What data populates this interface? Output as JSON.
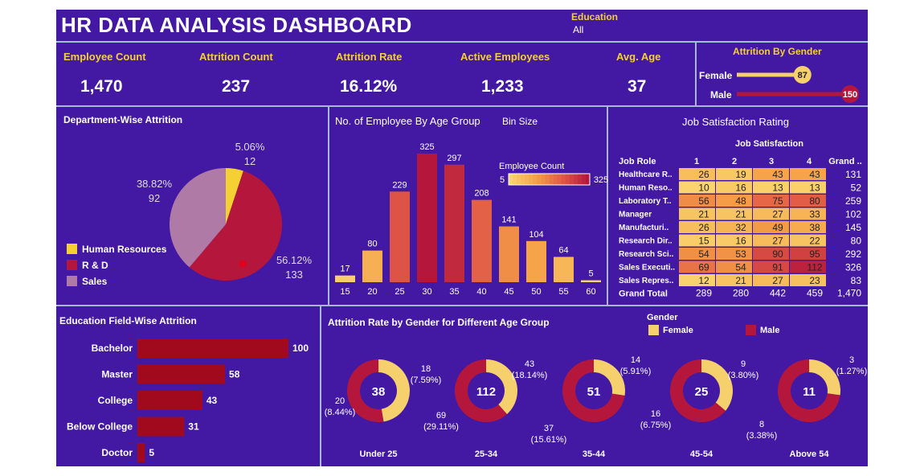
{
  "header": {
    "title": "HR DATA ANALYSIS DASHBOARD",
    "filter_label": "Education",
    "filter_value": "All"
  },
  "kpis": [
    {
      "label": "Employee Count",
      "value": "1,470"
    },
    {
      "label": "Attrition Count",
      "value": "237"
    },
    {
      "label": "Attrition Rate",
      "value": "16.12%"
    },
    {
      "label": "Active Employees",
      "value": "1,233"
    },
    {
      "label": "Avg. Age",
      "value": "37"
    }
  ],
  "colors": {
    "background": "#4319a3",
    "accent_yellow": "#f5d033",
    "female": "#f5d06c",
    "male": "#b5173c",
    "edu_bar": "#a10a1c",
    "sales": "#b07aa6",
    "hr": "#f5d033",
    "rd": "#b5173c"
  },
  "chart_data": [
    {
      "id": "gender",
      "type": "bar",
      "title": "Attrition By Gender",
      "categories": [
        "Female",
        "Male"
      ],
      "values": [
        87,
        150
      ],
      "value_labels": [
        "87",
        "150"
      ]
    },
    {
      "id": "department",
      "type": "pie",
      "title": "Department-Wise Attrition",
      "legend": [
        "Human Resources",
        "R & D",
        "Sales"
      ],
      "slices": [
        {
          "name": "Human Resources",
          "value": 12,
          "percent": "5.06%",
          "label": "12"
        },
        {
          "name": "R & D",
          "value": 133,
          "percent": "56.12%",
          "label": "133"
        },
        {
          "name": "Sales",
          "value": 92,
          "percent": "38.82%",
          "label": "92"
        }
      ]
    },
    {
      "id": "age_group",
      "type": "bar",
      "title": "No. of Employee By Age Group",
      "bin_label": "Bin Size",
      "legend_title": "Employee Count",
      "legend_min": "5",
      "legend_max": "325",
      "categories": [
        "15",
        "20",
        "25",
        "30",
        "35",
        "40",
        "45",
        "50",
        "55",
        "60"
      ],
      "values": [
        17,
        80,
        229,
        325,
        297,
        208,
        141,
        104,
        64,
        5
      ],
      "value_labels": [
        "17",
        "80",
        "229",
        "325",
        "297",
        "208",
        "141",
        "104",
        "64",
        "5"
      ]
    },
    {
      "id": "job_satisfaction",
      "type": "heatmap",
      "title": "Job Satisfaction Rating",
      "column_group": "Job Satisfaction",
      "row_header": "Job Role",
      "columns": [
        "1",
        "2",
        "3",
        "4",
        "Grand .."
      ],
      "rows": [
        {
          "role": "Healthcare R..",
          "values": [
            26,
            19,
            43,
            43
          ],
          "labels": [
            "26",
            "19",
            "43",
            "43"
          ],
          "total": "131"
        },
        {
          "role": "Human Reso..",
          "values": [
            10,
            16,
            13,
            13
          ],
          "labels": [
            "10",
            "16",
            "13",
            "13"
          ],
          "total": "52"
        },
        {
          "role": "Laboratory T..",
          "values": [
            56,
            48,
            75,
            80
          ],
          "labels": [
            "56",
            "48",
            "75",
            "80"
          ],
          "total": "259"
        },
        {
          "role": "Manager",
          "values": [
            21,
            21,
            27,
            33
          ],
          "labels": [
            "21",
            "21",
            "27",
            "33"
          ],
          "total": "102"
        },
        {
          "role": "Manufacturi..",
          "values": [
            26,
            32,
            49,
            38
          ],
          "labels": [
            "26",
            "32",
            "49",
            "38"
          ],
          "total": "145"
        },
        {
          "role": "Research Dir..",
          "values": [
            15,
            16,
            27,
            22
          ],
          "labels": [
            "15",
            "16",
            "27",
            "22"
          ],
          "total": "80"
        },
        {
          "role": "Research Sci..",
          "values": [
            54,
            53,
            90,
            95
          ],
          "labels": [
            "54",
            "53",
            "90",
            "95"
          ],
          "total": "292"
        },
        {
          "role": "Sales Executi..",
          "values": [
            69,
            54,
            91,
            112
          ],
          "labels": [
            "69",
            "54",
            "91",
            "112"
          ],
          "total": "326"
        },
        {
          "role": "Sales Repres..",
          "values": [
            12,
            21,
            27,
            23
          ],
          "labels": [
            "12",
            "21",
            "27",
            "23"
          ],
          "total": "83"
        }
      ],
      "grand_total": {
        "label": "Grand Total",
        "values": [
          "289",
          "280",
          "442",
          "459",
          "1,470"
        ]
      }
    },
    {
      "id": "education_field",
      "type": "bar",
      "title": "Education Field-Wise Attrition",
      "categories": [
        "Bachelor",
        "Master",
        "College",
        "Below College",
        "Doctor"
      ],
      "values": [
        100,
        58,
        43,
        31,
        5
      ],
      "value_labels": [
        "100",
        "58",
        "43",
        "31",
        "5"
      ]
    },
    {
      "id": "gender_age",
      "type": "pie",
      "title": "Attrition Rate by Gender for Different Age Group",
      "legend_title": "Gender",
      "legend": [
        "Female",
        "Male"
      ],
      "groups": [
        {
          "name": "Under 25",
          "total": "38",
          "female": 18,
          "male": 20,
          "female_label": [
            "18",
            "(7.59%)"
          ],
          "male_label": [
            "20",
            "(8.44%)"
          ]
        },
        {
          "name": "25-34",
          "total": "112",
          "female": 43,
          "male": 69,
          "female_label": [
            "43",
            "(18.14%)"
          ],
          "male_label": [
            "69",
            "(29.11%)"
          ]
        },
        {
          "name": "35-44",
          "total": "51",
          "female": 14,
          "male": 37,
          "female_label": [
            "14",
            "(5.91%)"
          ],
          "male_label": [
            "37",
            "(15.61%)"
          ]
        },
        {
          "name": "45-54",
          "total": "25",
          "female": 9,
          "male": 16,
          "female_label": [
            "9",
            "(3.80%)"
          ],
          "male_label": [
            "16",
            "(6.75%)"
          ]
        },
        {
          "name": "Above 54",
          "total": "11",
          "female": 3,
          "male": 8,
          "female_label": [
            "3",
            "(1.27%)"
          ],
          "male_label": [
            "8",
            "(3.38%)"
          ]
        }
      ]
    }
  ]
}
